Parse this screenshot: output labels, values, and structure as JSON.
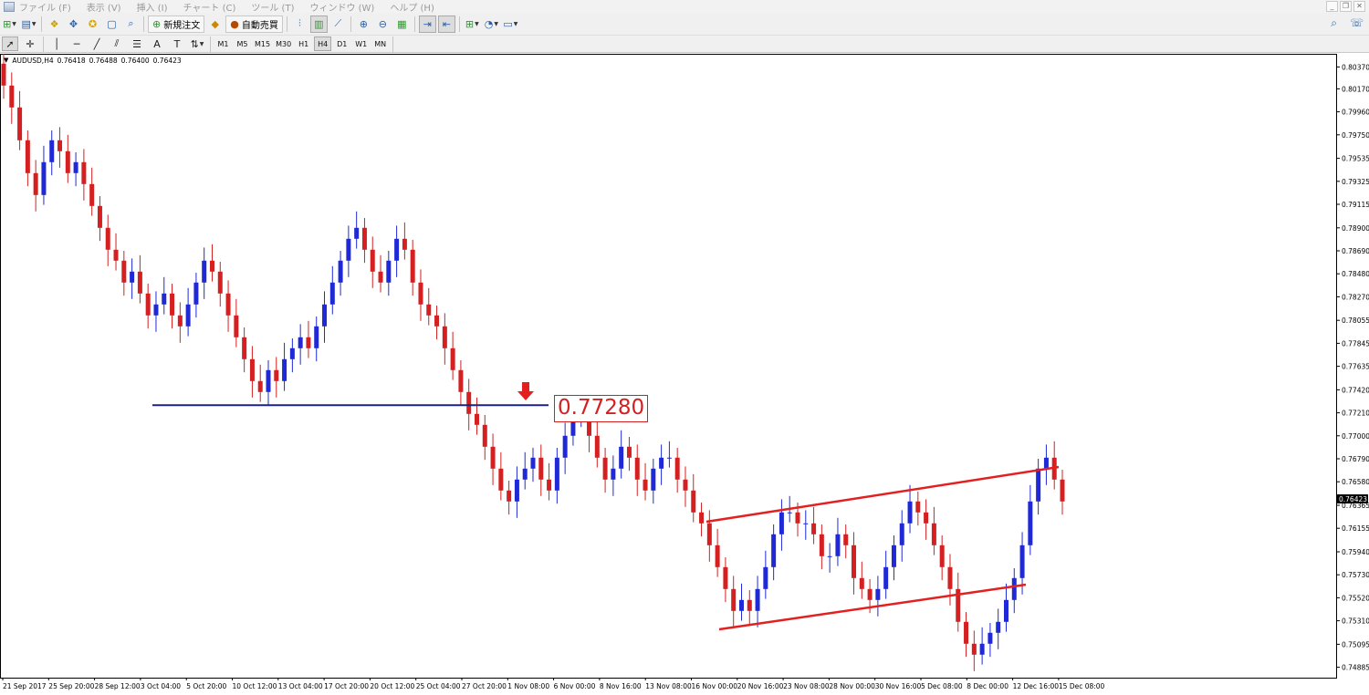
{
  "menu": [
    "ファイル (F)",
    "表示 (V)",
    "挿入 (I)",
    "チャート (C)",
    "ツール (T)",
    "ウィンドウ (W)",
    "ヘルプ (H)"
  ],
  "toolbar": {
    "new_order_label": "新規注文",
    "auto_trade_label": "自動売買"
  },
  "timeframes": [
    "M1",
    "M5",
    "M15",
    "M30",
    "H1",
    "H4",
    "D1",
    "W1",
    "MN"
  ],
  "active_timeframe": "H4",
  "chart_header": {
    "symbol": "AUDUSD,H4",
    "open": "0.76418",
    "high": "0.76488",
    "low": "0.76400",
    "close": "0.76423"
  },
  "annotation": {
    "price_label": "0.77280",
    "level": 0.7728,
    "color": "#d42020"
  },
  "colors": {
    "bull": "#1f2ad6",
    "bear": "#d42020",
    "support_line": "#1a237e",
    "channel": "#e32020"
  },
  "chart_data": {
    "type": "candlestick",
    "symbol": "AUDUSD",
    "timeframe": "H4",
    "ylim": [
      0.7479,
      0.8049
    ],
    "y_ticks": [
      "0.80370",
      "0.80170",
      "0.79960",
      "0.79750",
      "0.79535",
      "0.79325",
      "0.79115",
      "0.78900",
      "0.78690",
      "0.78480",
      "0.78270",
      "0.78055",
      "0.77845",
      "0.77635",
      "0.77420",
      "0.77210",
      "0.77000",
      "0.76790",
      "0.76580",
      "0.76365",
      "0.76155",
      "0.75940",
      "0.75730",
      "0.75520",
      "0.75310",
      "0.75095",
      "0.74885"
    ],
    "current_price": "0.76423",
    "x_ticks": [
      "21 Sep 2017",
      "25 Sep 20:00",
      "28 Sep 12:00",
      "3 Oct 04:00",
      "5 Oct 20:00",
      "10 Oct 12:00",
      "13 Oct 04:00",
      "17 Oct 20:00",
      "20 Oct 12:00",
      "25 Oct 04:00",
      "27 Oct 20:00",
      "1 Nov 08:00",
      "6 Nov 00:00",
      "8 Nov 16:00",
      "13 Nov 08:00",
      "16 Nov 00:00",
      "20 Nov 16:00",
      "23 Nov 08:00",
      "28 Nov 00:00",
      "30 Nov 16:00",
      "5 Dec 08:00",
      "8 Dec 00:00",
      "12 Dec 16:00",
      "15 Dec 08:00"
    ],
    "series": [
      {
        "name": "close",
        "values": [
          0.802,
          0.8,
          0.797,
          0.794,
          0.792,
          0.795,
          0.797,
          0.796,
          0.794,
          0.795,
          0.793,
          0.791,
          0.789,
          0.787,
          0.786,
          0.784,
          0.785,
          0.783,
          0.781,
          0.782,
          0.783,
          0.781,
          0.78,
          0.782,
          0.784,
          0.786,
          0.785,
          0.783,
          0.781,
          0.779,
          0.777,
          0.775,
          0.774,
          0.776,
          0.775,
          0.777,
          0.778,
          0.779,
          0.778,
          0.78,
          0.782,
          0.784,
          0.786,
          0.788,
          0.789,
          0.787,
          0.785,
          0.784,
          0.786,
          0.788,
          0.787,
          0.784,
          0.782,
          0.781,
          0.78,
          0.778,
          0.776,
          0.774,
          0.772,
          0.771,
          0.769,
          0.767,
          0.765,
          0.764,
          0.766,
          0.767,
          0.768,
          0.766,
          0.765,
          0.768,
          0.77,
          0.772,
          0.772,
          0.77,
          0.768,
          0.766,
          0.767,
          0.769,
          0.768,
          0.766,
          0.765,
          0.767,
          0.768,
          0.768,
          0.766,
          0.765,
          0.763,
          0.762,
          0.76,
          0.758,
          0.756,
          0.754,
          0.755,
          0.754,
          0.756,
          0.758,
          0.761,
          0.763,
          0.763,
          0.762,
          0.762,
          0.761,
          0.759,
          0.759,
          0.761,
          0.76,
          0.757,
          0.756,
          0.755,
          0.756,
          0.758,
          0.76,
          0.762,
          0.764,
          0.763,
          0.762,
          0.76,
          0.758,
          0.756,
          0.753,
          0.751,
          0.75,
          0.751,
          0.752,
          0.753,
          0.755,
          0.757,
          0.76,
          0.764,
          0.767,
          0.768,
          0.766,
          0.764
        ]
      }
    ],
    "annotations": [
      {
        "type": "horizontal_line",
        "value": 0.7728,
        "color": "blue"
      },
      {
        "type": "label",
        "value": "0.77280"
      },
      {
        "type": "channel_upper",
        "from": [
          0.7629,
          "16 Nov 00:00"
        ],
        "to": [
          0.7674,
          "15 Dec 08:00"
        ]
      },
      {
        "type": "channel_lower",
        "from": [
          0.7528,
          "16 Nov 00:00"
        ],
        "to": [
          0.7569,
          "12 Dec 16:00"
        ]
      }
    ]
  }
}
